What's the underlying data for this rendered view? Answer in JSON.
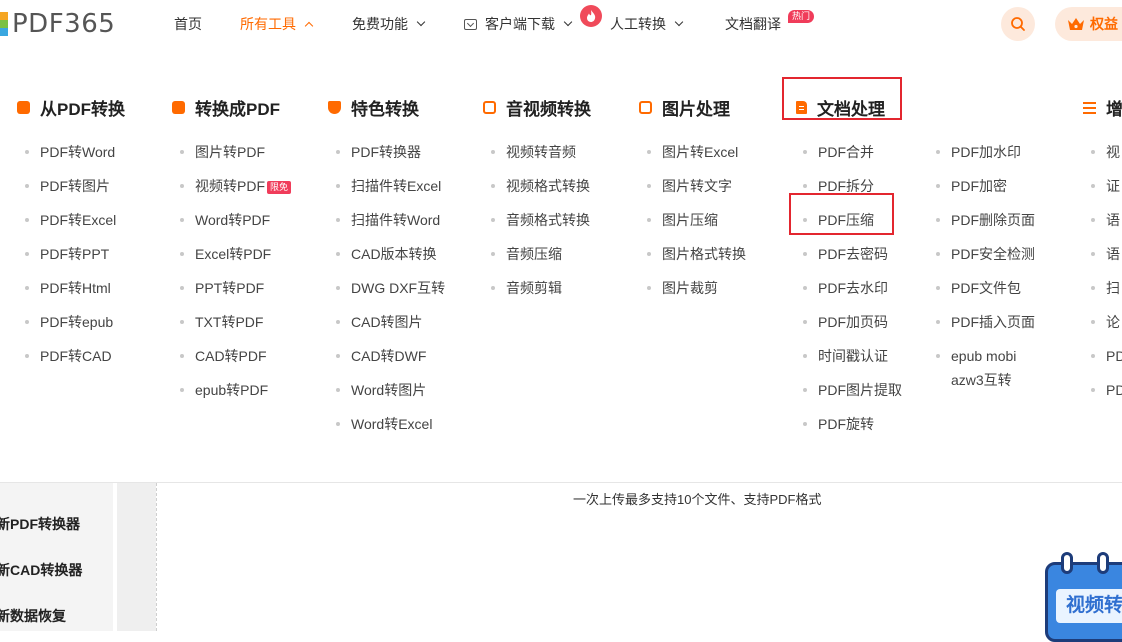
{
  "header": {
    "logo_text": "PDF365",
    "nav": [
      {
        "label": "首页"
      },
      {
        "label": "所有工具"
      },
      {
        "label": "免费功能"
      },
      {
        "label": "客户端下载"
      },
      {
        "label": "人工转换"
      },
      {
        "label": "文档翻译",
        "badge": "热门"
      }
    ],
    "rights_label": "权益",
    "accent_color": "#ff6a00"
  },
  "menu": {
    "categories": [
      {
        "title": "从PDF转换",
        "icon": "pdf-convert-icon",
        "items": [
          "PDF转Word",
          "PDF转图片",
          "PDF转Excel",
          "PDF转PPT",
          "PDF转Html",
          "PDF转epub",
          "PDF转CAD"
        ]
      },
      {
        "title": "转换成PDF",
        "icon": "to-pdf-icon",
        "items": [
          "图片转PDF",
          "视频转PDF",
          "Word转PDF",
          "Excel转PDF",
          "PPT转PDF",
          "TXT转PDF",
          "CAD转PDF",
          "epub转PDF"
        ],
        "item_badge": "限免"
      },
      {
        "title": "特色转换",
        "icon": "shield-star-icon",
        "items": [
          "PDF转换器",
          "扫描件转Excel",
          "扫描件转Word",
          "CAD版本转换",
          "DWG DXF互转",
          "CAD转图片",
          "CAD转DWF",
          "Word转图片",
          "Word转Excel"
        ]
      },
      {
        "title": "音视频转换",
        "icon": "media-icon",
        "items": [
          "视频转音频",
          "视频格式转换",
          "音频格式转换",
          "音频压缩",
          "音频剪辑"
        ]
      },
      {
        "title": "图片处理",
        "icon": "image-icon",
        "items": [
          "图片转Excel",
          "图片转文字",
          "图片压缩",
          "图片格式转换",
          "图片裁剪"
        ]
      },
      {
        "title": "文档处理",
        "icon": "document-icon",
        "items": [
          "PDF合并",
          "PDF拆分",
          "PDF压缩",
          "PDF去密码",
          "PDF去水印",
          "PDF加页码",
          "时间戳认证",
          "PDF图片提取",
          "PDF旋转"
        ],
        "items_col2": [
          "PDF加水印",
          "PDF加密",
          "PDF删除页面",
          "PDF安全检测",
          "PDF文件包",
          "PDF插入页面",
          "epub mobi",
          "azw3互转"
        ]
      },
      {
        "title": "增",
        "icon": "list-icon",
        "items": [
          "视",
          "证",
          "语",
          "语",
          "扫",
          "论",
          "PD",
          "PD"
        ]
      }
    ]
  },
  "sidebar": {
    "items": [
      "新PDF转换器",
      "新CAD转换器",
      "新数据恢复"
    ]
  },
  "upload": {
    "hint": "一次上传最多支持10个文件、支持PDF格式"
  },
  "promo": {
    "label": "视频转"
  }
}
